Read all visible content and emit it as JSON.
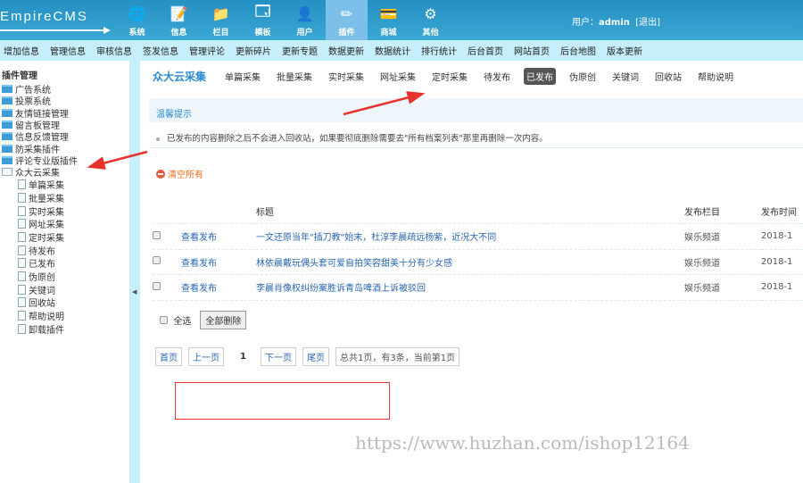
{
  "header": {
    "logo": "EmpireCMS",
    "user_label": "用户：",
    "user_name": "admin",
    "logout": "[退出]",
    "nav": [
      {
        "label": "系统",
        "icon": "globe-icon",
        "sym": "🌐"
      },
      {
        "label": "信息",
        "icon": "edit-icon",
        "sym": "📝"
      },
      {
        "label": "栏目",
        "icon": "folder-icon",
        "sym": "📁"
      },
      {
        "label": "模板",
        "icon": "window-icon",
        "sym": "🗔"
      },
      {
        "label": "用户",
        "icon": "user-icon",
        "sym": "👤"
      },
      {
        "label": "插件",
        "icon": "tools-icon",
        "sym": "✏"
      },
      {
        "label": "商城",
        "icon": "card-icon",
        "sym": "💳"
      },
      {
        "label": "其他",
        "icon": "gear-icon",
        "sym": "⚙"
      }
    ]
  },
  "menu": [
    "增加信息",
    "管理信息",
    "审核信息",
    "签发信息",
    "管理评论",
    "更新碎片",
    "更新专题",
    "数据更新",
    "数据统计",
    "排行统计",
    "后台首页",
    "网站首页",
    "后台地图",
    "版本更新"
  ],
  "sidebar": {
    "root": "插件管理",
    "folders": [
      "广告系统",
      "投票系统",
      "友情链接管理",
      "留言板管理",
      "信息反馈管理",
      "防采集插件",
      "评论专业版插件"
    ],
    "open_folder": "众大云采集",
    "leaves": [
      "单篇采集",
      "批量采集",
      "实时采集",
      "网址采集",
      "定时采集",
      "待发布",
      "已发布",
      "伪原创",
      "关键词",
      "回收站",
      "帮助说明",
      "卸载插件"
    ]
  },
  "main": {
    "title": "众大云采集",
    "tabs": [
      "单篇采集",
      "批量采集",
      "实时采集",
      "网址采集",
      "定时采集",
      "待发布",
      "已发布",
      "伪原创",
      "关键词",
      "回收站",
      "帮助说明"
    ],
    "active_tab": "已发布",
    "tip_title": "温馨提示",
    "tip_text": "已发布的内容删除之后不会进入回收站，如果要彻底删除需要去\"所有档案列表\"那里再删除一次内容。",
    "clear_all": "清空所有",
    "columns": [
      "",
      "",
      "标题",
      "发布栏目",
      "发布时间"
    ],
    "rows": [
      {
        "action": "查看发布",
        "title": "一文还原当年\"插刀教\"始末，杜淳李晨疏远杨紫，近况大不同",
        "column": "娱乐频道",
        "time": "2018-1"
      },
      {
        "action": "查看发布",
        "title": "林依晨戴玩偶头套可爱自拍笑容甜美十分有少女感",
        "column": "娱乐频道",
        "time": "2018-1"
      },
      {
        "action": "查看发布",
        "title": "李晨肖像权纠纷案胜诉青岛啤酒上诉被驳回",
        "column": "娱乐频道",
        "time": "2018-1"
      }
    ],
    "select_all": "全选",
    "delete_all": "全部删除",
    "pager": {
      "first": "首页",
      "prev": "上一页",
      "current": "1",
      "next": "下一页",
      "last": "尾页",
      "info": "总共1页，有3条，当前第1页"
    }
  },
  "watermark": "https://www.huzhan.com/ishop12164"
}
